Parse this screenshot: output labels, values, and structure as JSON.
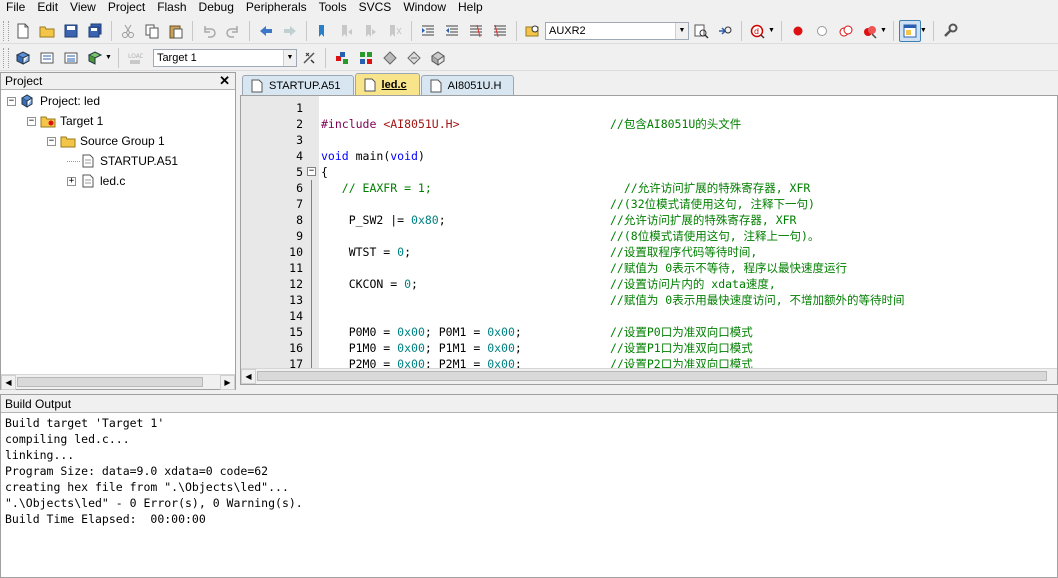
{
  "menu": [
    "File",
    "Edit",
    "View",
    "Project",
    "Flash",
    "Debug",
    "Peripherals",
    "Tools",
    "SVCS",
    "Window",
    "Help"
  ],
  "toolbar1": {
    "find_combo_value": "AUXR2"
  },
  "toolbar2": {
    "target_combo_value": "Target 1"
  },
  "project_pane": {
    "title": "Project",
    "close": "✕",
    "tree": [
      {
        "label": "Project: led",
        "level": 0,
        "expander": "−"
      },
      {
        "label": "Target 1",
        "level": 1,
        "expander": "−"
      },
      {
        "label": "Source Group 1",
        "level": 2,
        "expander": "−"
      },
      {
        "label": "STARTUP.A51",
        "level": 3,
        "expander": ""
      },
      {
        "label": "led.c",
        "level": 3,
        "expander": "+"
      }
    ]
  },
  "editor": {
    "tabs": [
      {
        "label": "STARTUP.A51",
        "active": false
      },
      {
        "label": "led.c",
        "active": true
      },
      {
        "label": "AI8051U.H",
        "active": false
      }
    ],
    "lines": [
      {
        "n": "1",
        "code": "",
        "comment": ""
      },
      {
        "n": "2",
        "code": "#include <AI8051U.H>",
        "comment": "//包含AI8051U的头文件"
      },
      {
        "n": "3",
        "code": "",
        "comment": ""
      },
      {
        "n": "4",
        "code": "void main(void)",
        "comment": ""
      },
      {
        "n": "5",
        "code": "{",
        "comment": ""
      },
      {
        "n": "6",
        "code": "   // EAXFR = 1;",
        "comment": "  //允许访问扩展的特殊寄存器, XFR"
      },
      {
        "n": "7",
        "code": "",
        "comment": "//(32位模式请使用这句, 注释下一句)"
      },
      {
        "n": "8",
        "code": "    P_SW2 |= 0x80;",
        "comment": "//允许访问扩展的特殊寄存器, XFR"
      },
      {
        "n": "9",
        "code": "",
        "comment": "//(8位模式请使用这句, 注释上一句)。"
      },
      {
        "n": "10",
        "code": "    WTST = 0;",
        "comment": "//设置取程序代码等待时间,"
      },
      {
        "n": "11",
        "code": "",
        "comment": "//赋值为 0表示不等待, 程序以最快速度运行"
      },
      {
        "n": "12",
        "code": "    CKCON = 0;",
        "comment": "//设置访问片内的 xdata速度,"
      },
      {
        "n": "13",
        "code": "",
        "comment": "//赋值为 0表示用最快速度访问, 不增加额外的等待时间"
      },
      {
        "n": "14",
        "code": "",
        "comment": ""
      },
      {
        "n": "15",
        "code": "    P0M0 = 0x00; P0M1 = 0x00;",
        "comment": "//设置P0口为准双向口模式"
      },
      {
        "n": "16",
        "code": "    P1M0 = 0x00; P1M1 = 0x00;",
        "comment": "//设置P1口为准双向口模式"
      },
      {
        "n": "17",
        "code": "    P2M0 = 0x00; P2M1 = 0x00;",
        "comment": "//设置P2口为准双向口模式"
      }
    ]
  },
  "build_output": {
    "title": "Build Output",
    "lines": [
      "Build target 'Target 1'",
      "compiling led.c...",
      "linking...",
      "Program Size: data=9.0 xdata=0 code=62",
      "creating hex file from \".\\Objects\\led\"...",
      "\".\\Objects\\led\" - 0 Error(s), 0 Warning(s).",
      "Build Time Elapsed:  00:00:00"
    ]
  }
}
